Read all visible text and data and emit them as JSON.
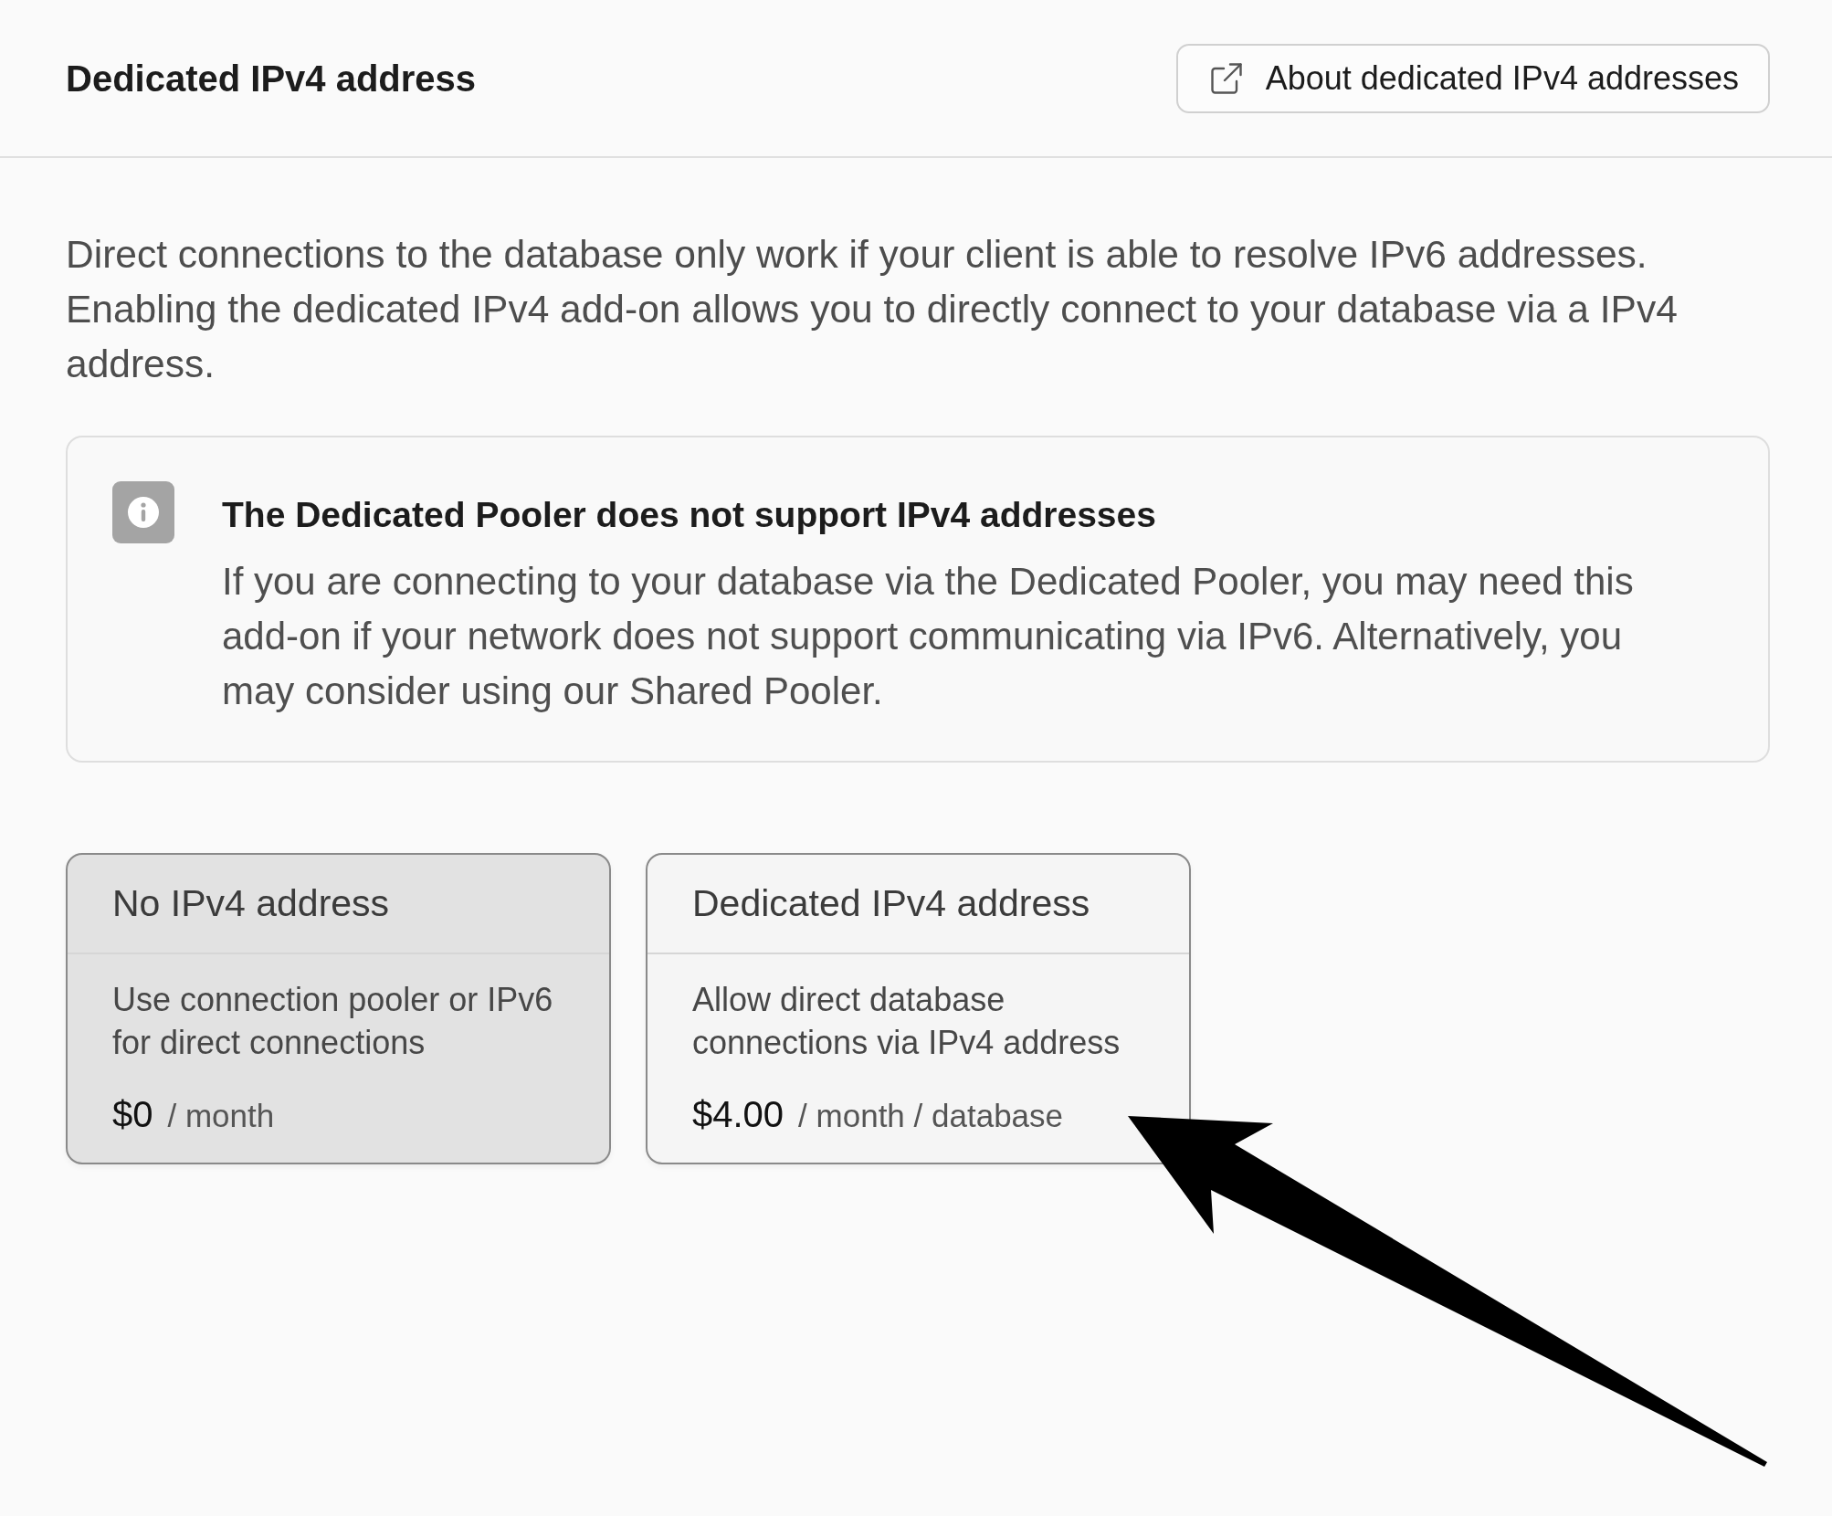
{
  "header": {
    "title": "Dedicated IPv4 address",
    "link_button": {
      "label": "About dedicated IPv4 addresses"
    }
  },
  "description": "Direct connections to the database only work if your client is able to resolve IPv6 addresses. Enabling the dedicated IPv4 add-on allows you to directly connect to your database via a IPv4 address.",
  "notice": {
    "title": "The Dedicated Pooler does not support IPv4 addresses",
    "body": "If you are connecting to your database via the Dedicated Pooler, you may need this add-on if your network does not support communicating via IPv6. Alternatively, you may consider using our Shared Pooler."
  },
  "options": [
    {
      "title": "No IPv4 address",
      "description": "Use connection pooler or IPv6 for direct connections",
      "price": "$0",
      "unit": "/ month",
      "selected": true
    },
    {
      "title": "Dedicated IPv4 address",
      "description": "Allow direct database connections via IPv4 address",
      "price": "$4.00",
      "unit": "/ month / database",
      "selected": false
    }
  ]
}
